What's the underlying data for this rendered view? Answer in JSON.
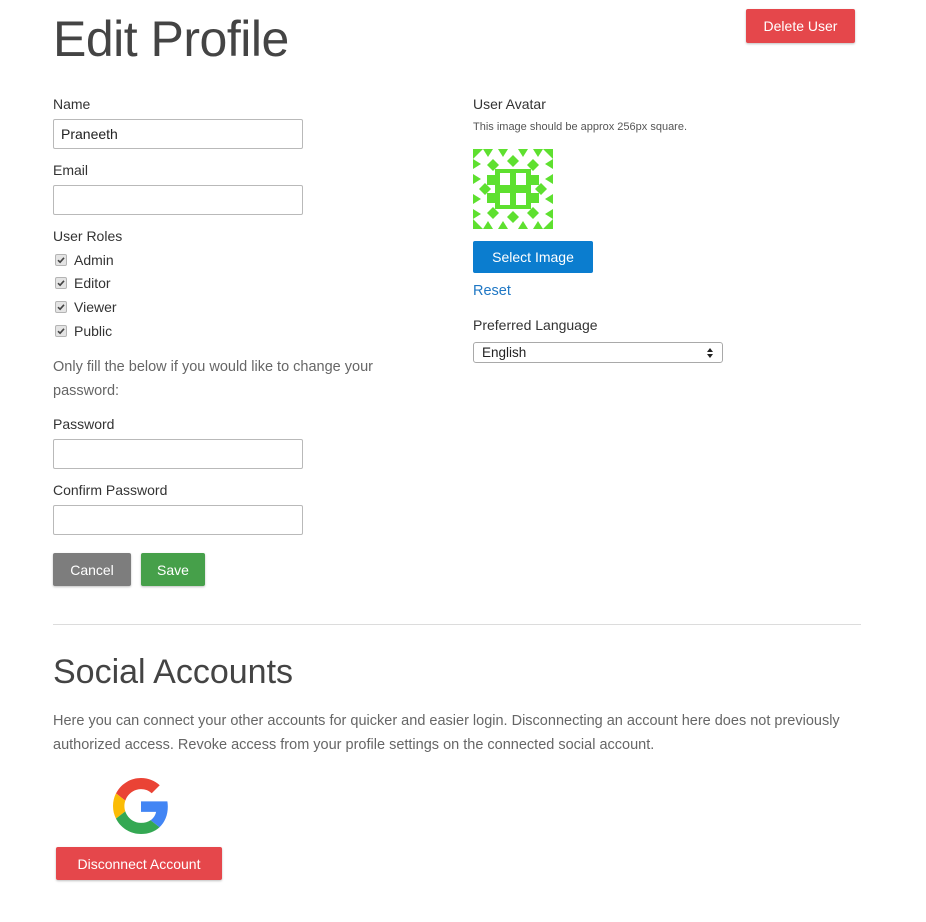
{
  "header": {
    "title": "Edit Profile",
    "delete_user_label": "Delete User"
  },
  "form": {
    "name_label": "Name",
    "name_value": "Praneeth",
    "email_label": "Email",
    "email_value": "",
    "roles_label": "User Roles",
    "roles": [
      {
        "label": "Admin",
        "checked": true
      },
      {
        "label": "Editor",
        "checked": true
      },
      {
        "label": "Viewer",
        "checked": true
      },
      {
        "label": "Public",
        "checked": true
      }
    ],
    "password_help": "Only fill the below if you would like to change your password:",
    "password_label": "Password",
    "password_value": "",
    "confirm_password_label": "Confirm Password",
    "confirm_password_value": "",
    "cancel_label": "Cancel",
    "save_label": "Save"
  },
  "avatar": {
    "label": "User Avatar",
    "note": "This image should be approx 256px square.",
    "select_image_label": "Select Image",
    "reset_label": "Reset",
    "avatar_color": "#5ee02f"
  },
  "language": {
    "label": "Preferred Language",
    "selected": "English"
  },
  "social": {
    "title": "Social Accounts",
    "description": "Here you can connect your other accounts for quicker and easier login. Disconnecting an account here does not previously authorized access. Revoke access from your profile settings on the connected social account.",
    "provider_icon": "google-icon",
    "disconnect_label": "Disconnect Account"
  },
  "colors": {
    "danger": "#e5474b",
    "primary": "#0b7dcf",
    "success": "#46a04a",
    "neutral": "#7d7d7d",
    "link": "#1f77c4"
  }
}
